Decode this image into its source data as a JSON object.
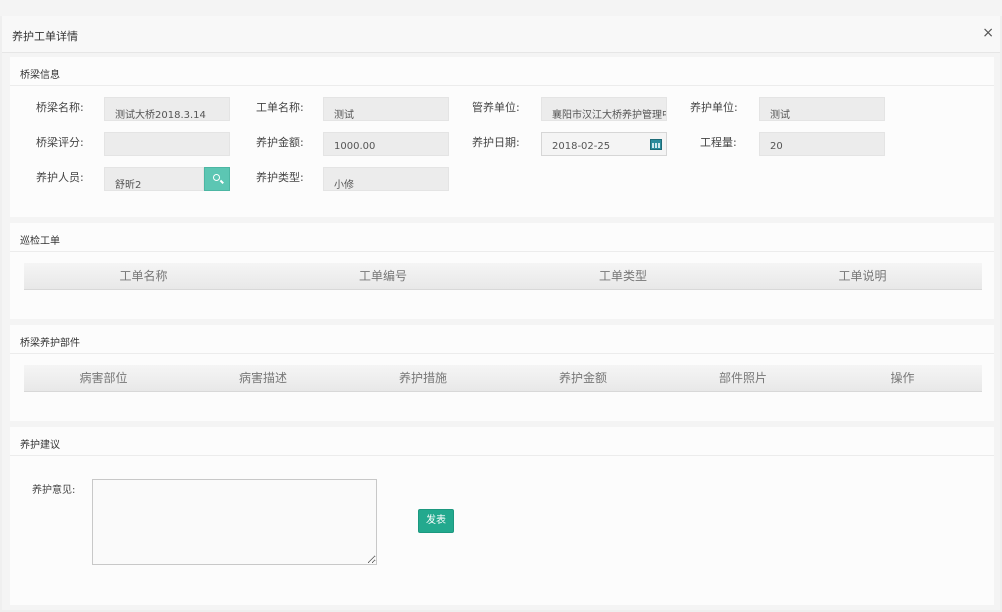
{
  "dialog": {
    "title": "养护工单详情",
    "close_glyph": "×"
  },
  "bridge_info": {
    "section_title": "桥梁信息",
    "fields": {
      "bridge_name": {
        "label": "桥梁名称:",
        "value": "测试大桥2018.3.14"
      },
      "order_name": {
        "label": "工单名称:",
        "value": "测试"
      },
      "manage_unit": {
        "label": "管养单位:",
        "value": "襄阳市汉江大桥养护管理中"
      },
      "maint_unit": {
        "label": "养护单位:",
        "value": "测试"
      },
      "bridge_rating": {
        "label": "桥梁评分:",
        "value": ""
      },
      "maint_amount": {
        "label": "养护金额:",
        "value": "1000.00"
      },
      "maint_date": {
        "label": "养护日期:",
        "value": "2018-02-25"
      },
      "workload": {
        "label": "工程量:",
        "value": "20"
      },
      "maint_person": {
        "label": "养护人员:",
        "value": "舒昕2"
      },
      "maint_type": {
        "label": "养护类型:",
        "value": "小修"
      }
    }
  },
  "inspection": {
    "section_title": "巡检工单",
    "columns": [
      "工单名称",
      "工单编号",
      "工单类型",
      "工单说明"
    ],
    "rows": []
  },
  "components": {
    "section_title": "桥梁养护部件",
    "columns": [
      "病害部位",
      "病害描述",
      "养护措施",
      "养护金额",
      "部件照片",
      "操作"
    ],
    "rows": []
  },
  "advice": {
    "section_title": "养护建议",
    "opinion_label": "养护意见:",
    "opinion_value": "",
    "publish_label": "发表"
  },
  "colors": {
    "accent": "#23a98e",
    "search_button": "#5cc6b3",
    "calendar_icon": "#2c8c9c"
  }
}
